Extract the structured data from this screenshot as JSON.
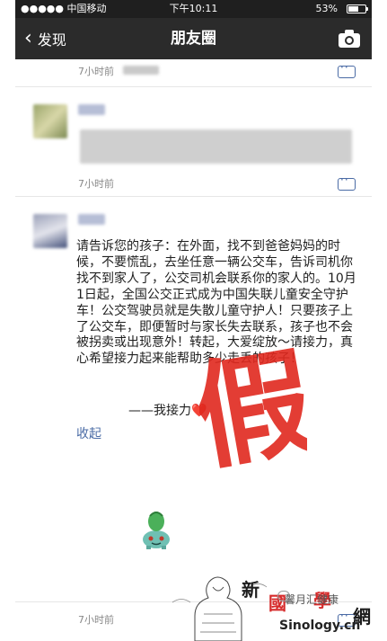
{
  "status_bar": {
    "carrier": "●●●●● 中国移动",
    "time": "下午10:11",
    "battery": "53%",
    "battery_level": 0.53
  },
  "nav": {
    "back_label": "发现",
    "title": "朋友圈"
  },
  "posts": [
    {
      "time": "7小时前"
    },
    {
      "time": "7小时前"
    },
    {
      "body": "请告诉您的孩子：在外面，找不到爸爸妈妈的时候，不要慌乱，去坐任意一辆公交车，告诉司机你找不到家人了，公交司机会联系你的家人的。10月1日起，全国公交正式成为中国失联儿童安全守护车！公交驾驶员就是失散儿童守护人！只要孩子上了公交车，即便暂时与家长失去联系，孩子也不会被拐卖或出现意外！转起，大爱绽放～请接力，真心希望接力起来能帮助多少走丢的孩子！",
      "relay": "——我接力",
      "heart": "❤️",
      "collapse": "收起",
      "stamp_text": "假"
    },
    {
      "time": "7小时前"
    }
  ],
  "watermark": {
    "xin": "新",
    "guo": "國",
    "xue": "學",
    "wang": "網",
    "site": "Sinology.cn",
    "account": "馨月汇健康"
  },
  "colors": {
    "nav_bg": "#2b2b2b",
    "link": "#4a6ba5",
    "stamp_red": "#e0281e"
  },
  "icons": [
    "back-chevron-icon",
    "camera-icon",
    "comment-icon",
    "wifi-icon",
    "location-icon",
    "alarm-icon",
    "bluetooth-icon",
    "battery-icon"
  ]
}
